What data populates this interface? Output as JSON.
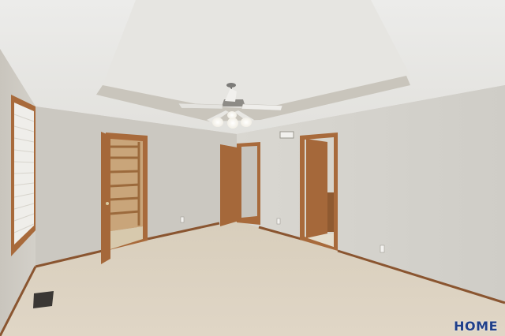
{
  "watermark": {
    "text": "HOME"
  },
  "colors": {
    "wall": "#d6d3cc",
    "ceiling": "#e9e8e4",
    "carpet": "#d9cfbd",
    "trim": "#8a5530",
    "door": "#a86a3b",
    "logo": "#1f3f8a"
  }
}
